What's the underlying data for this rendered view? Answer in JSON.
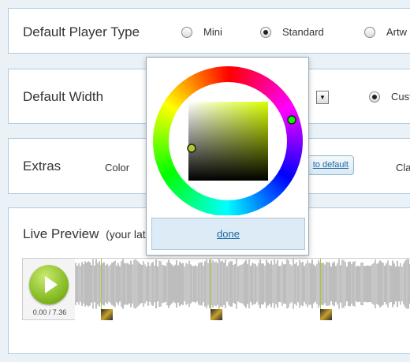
{
  "player_type": {
    "title": "Default Player Type",
    "options": [
      "Mini",
      "Standard",
      "Artw"
    ],
    "selected": "Standard"
  },
  "width": {
    "title": "Default Width",
    "custom_label": "Cust"
  },
  "extras": {
    "title": "Extras",
    "color_label": "Color",
    "default_button": "to default",
    "trailing_label": "Cla"
  },
  "preview": {
    "title": "Live Preview",
    "subtitle": "(your lat",
    "time": "0.00 / 7.36"
  },
  "color_picker": {
    "done_label": "done",
    "selected_hue_color": "#00ff00",
    "selected_color": "#aacc22",
    "square_base_color": "#d8ff00"
  },
  "colors": {
    "accent": "#7db51c",
    "link": "#1f6aa5",
    "panel_border": "#aecbdf",
    "page_bg": "#eaf2f8"
  }
}
